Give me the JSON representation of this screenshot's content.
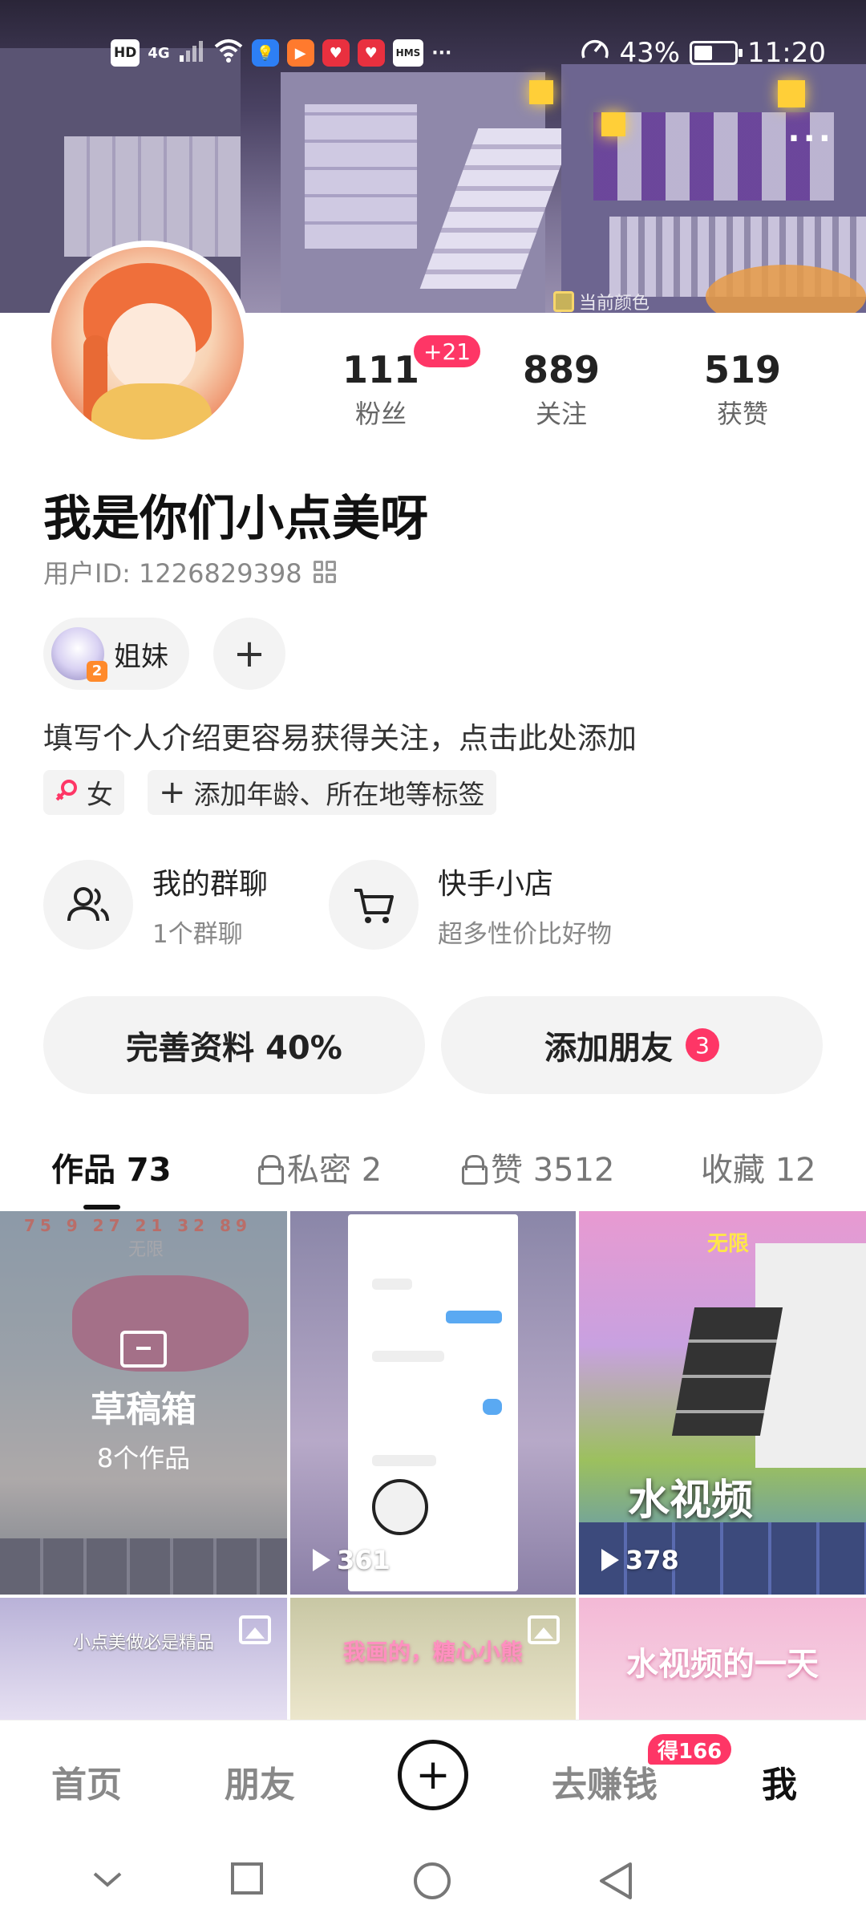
{
  "status_bar": {
    "icons": [
      "HD",
      "4G",
      "signal-icon",
      "wifi-icon",
      "bulb-app-icon",
      "play-app-icon",
      "heart-app-icon",
      "heart-app-icon",
      "HMS",
      "more-dots"
    ],
    "battery": "43%",
    "time": "11:20"
  },
  "banner": {
    "caption": "当前颜色"
  },
  "profile": {
    "stats": [
      {
        "value": "111",
        "label": "粉丝",
        "badge": "+21"
      },
      {
        "value": "889",
        "label": "关注"
      },
      {
        "value": "519",
        "label": "获赞"
      }
    ],
    "name": "我是你们小点美呀",
    "user_id": "用户ID: 1226829398",
    "group_chip": {
      "label": "姐妹",
      "count": "2"
    },
    "intro": "填写个人介绍更容易获得关注，点击此处添加",
    "tags": [
      {
        "label": "女",
        "icon": "female-icon"
      },
      {
        "label": "添加年龄、所在地等标签",
        "icon": "plus-icon"
      }
    ]
  },
  "features": [
    {
      "title": "我的群聊",
      "subtitle": "1个群聊",
      "icon": "group-chat-icon"
    },
    {
      "title": "快手小店",
      "subtitle": "超多性价比好物",
      "icon": "cart-icon"
    }
  ],
  "actions": {
    "complete_profile": "完善资料 40%",
    "add_friend": "添加朋友",
    "add_friend_count": "3"
  },
  "tabs": [
    {
      "label": "作品 73",
      "active": true
    },
    {
      "label": "私密 2",
      "locked": true
    },
    {
      "label": "赞 3512",
      "locked": true
    },
    {
      "label": "收藏 12"
    }
  ],
  "grid": {
    "draft": {
      "title": "草稿箱",
      "subtitle": "8个作品",
      "hud": "75 9 27 21 32 89",
      "overlay_text": "无限"
    },
    "videos": [
      {
        "plays": "361"
      },
      {
        "plays": "378",
        "caption": "水视频",
        "overlay_text": "无限"
      }
    ],
    "row2": [
      {
        "caption": "小点美做必是精品"
      },
      {
        "caption": "我画的，糖心小熊"
      },
      {
        "caption": "水视频的一天"
      }
    ]
  },
  "bottom_nav": {
    "items": [
      "首页",
      "朋友",
      "去赚钱",
      "我"
    ],
    "earn_badge": "得166"
  }
}
